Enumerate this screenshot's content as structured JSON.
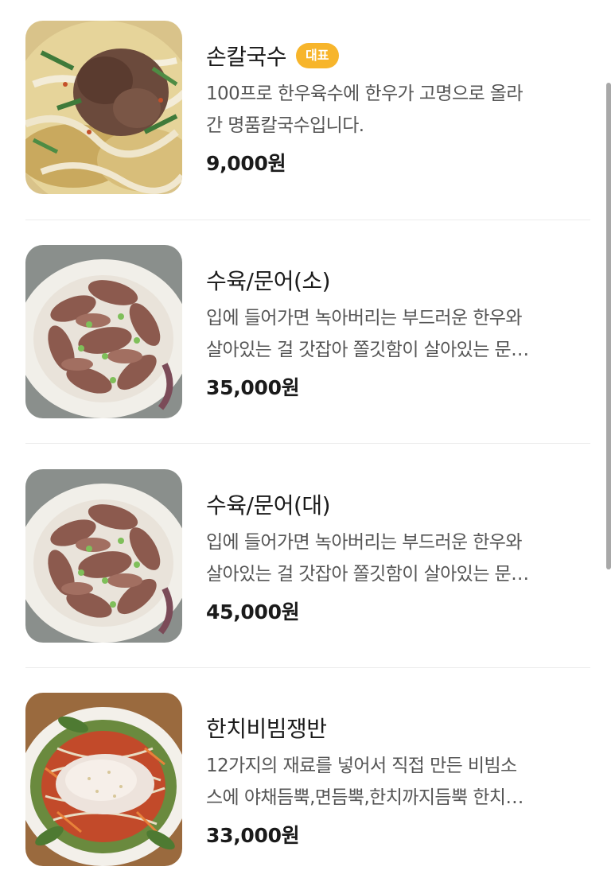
{
  "menu": {
    "items": [
      {
        "name": "손칼국수",
        "badge": "대표",
        "desc_line1": "100프로 한우육수에 한우가 고명으로 올라",
        "desc_line2": "간 명품칼국수입니다.",
        "price": "9,000원",
        "image_icon": "noodle-soup-photo"
      },
      {
        "name": "수육/문어(소)",
        "desc_line1": "입에 들어가면 녹아버리는 부드러운 한우와",
        "desc_line2": "살아있는 걸 갓잡아 쫄깃함이 살아있는 문…",
        "price": "35,000원",
        "image_icon": "boiled-beef-platter-photo"
      },
      {
        "name": "수육/문어(대)",
        "desc_line1": "입에 들어가면 녹아버리는 부드러운 한우와",
        "desc_line2": "살아있는 걸 갓잡아 쫄깃함이 살아있는 문…",
        "price": "45,000원",
        "image_icon": "boiled-beef-platter-photo"
      },
      {
        "name": "한치비빔쟁반",
        "desc_line1": "12가지의 재료를 넣어서 직접 만든 비빔소",
        "desc_line2": "스에 야채듬뿍,면듬뿍,한치까지듬뿍 한치…",
        "price": "33,000원",
        "image_icon": "squid-bibim-noodle-photo"
      }
    ]
  },
  "colors": {
    "badge": "#f7b52b",
    "text": "#1a1a1a",
    "description": "#555555",
    "divider": "#ececec"
  }
}
